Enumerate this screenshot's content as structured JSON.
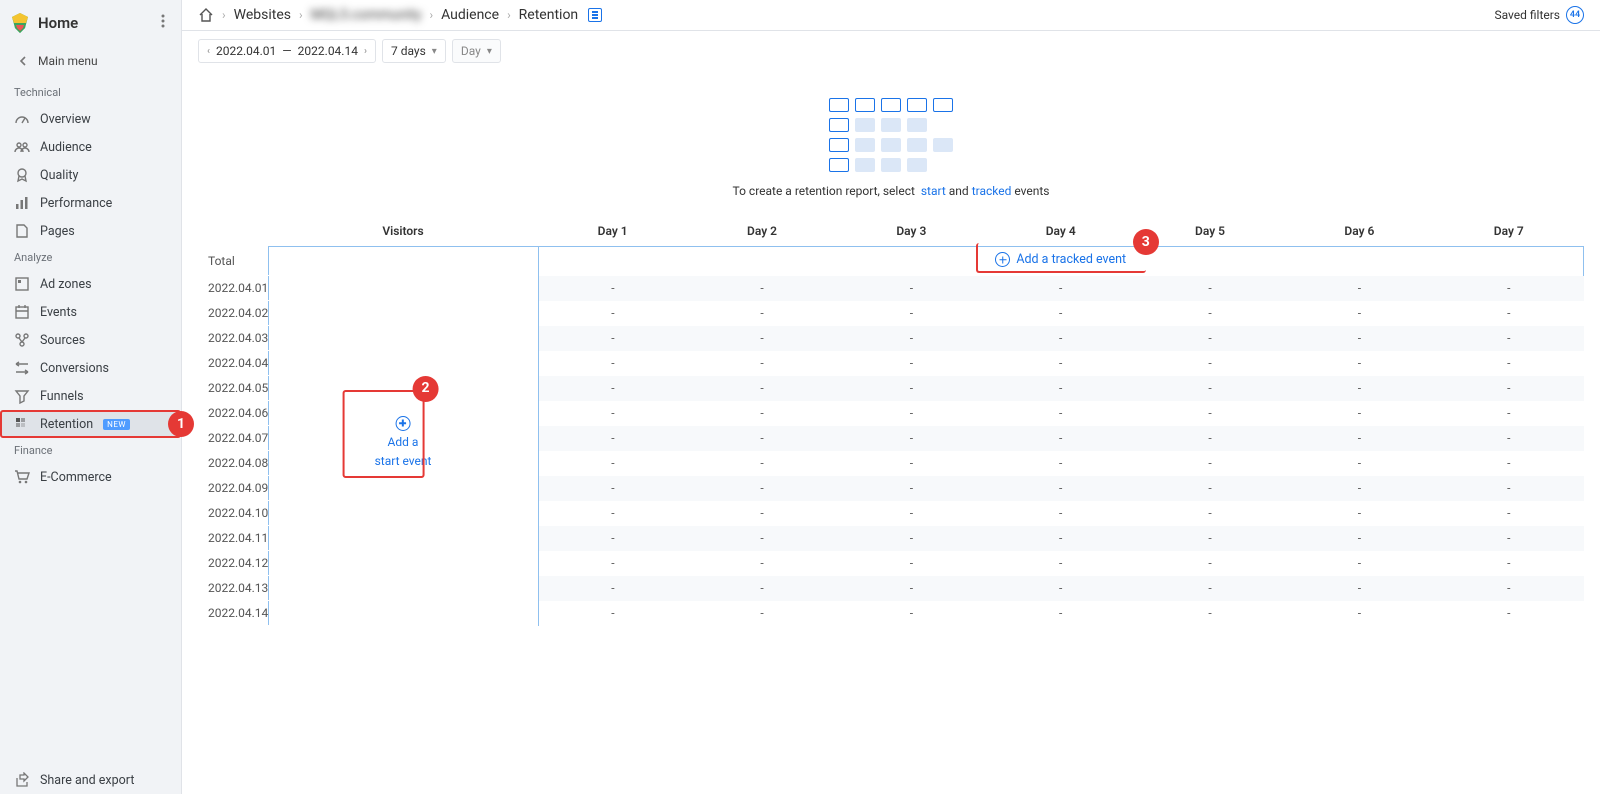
{
  "sidebar": {
    "title": "Home",
    "main_menu": "Main menu",
    "groups": [
      {
        "label": "Technical",
        "items": [
          {
            "icon": "speedometer",
            "label": "Overview"
          },
          {
            "icon": "audience",
            "label": "Audience"
          },
          {
            "icon": "medal",
            "label": "Quality"
          },
          {
            "icon": "bars",
            "label": "Performance"
          },
          {
            "icon": "page",
            "label": "Pages"
          }
        ]
      },
      {
        "label": "Analyze",
        "items": [
          {
            "icon": "adzones",
            "label": "Ad zones"
          },
          {
            "icon": "events",
            "label": "Events"
          },
          {
            "icon": "sources",
            "label": "Sources"
          },
          {
            "icon": "conversions",
            "label": "Conversions"
          },
          {
            "icon": "funnel",
            "label": "Funnels"
          },
          {
            "icon": "retention",
            "label": "Retention",
            "badge": "NEW",
            "active": true
          }
        ]
      },
      {
        "label": "Finance",
        "items": [
          {
            "icon": "cart",
            "label": "E-Commerce"
          }
        ]
      }
    ],
    "share_export": "Share and export"
  },
  "breadcrumbs": {
    "websites": "Websites",
    "site": "MQL5.community",
    "audience": "Audience",
    "retention": "Retention"
  },
  "top": {
    "saved_filters": "Saved filters",
    "saved_filters_count": "44"
  },
  "controls": {
    "date_from": "2022.04.01",
    "date_sep": "—",
    "date_to": "2022.04.14",
    "range": "7 days",
    "granularity": "Day"
  },
  "illus_caption": {
    "pre": "To create a retention report, select",
    "start": "start",
    "and": "and",
    "tracked": "tracked",
    "post": "events"
  },
  "table": {
    "headers": {
      "visitors": "Visitors",
      "days": [
        "Day 1",
        "Day 2",
        "Day 3",
        "Day 4",
        "Day 5",
        "Day 6",
        "Day 7"
      ]
    },
    "total_label": "Total",
    "add_tracked": "Add a tracked event",
    "add_start_l1": "Add a",
    "add_start_l2": "start event",
    "dates": [
      "2022.04.01",
      "2022.04.02",
      "2022.04.03",
      "2022.04.04",
      "2022.04.05",
      "2022.04.06",
      "2022.04.07",
      "2022.04.08",
      "2022.04.09",
      "2022.04.10",
      "2022.04.11",
      "2022.04.12",
      "2022.04.13",
      "2022.04.14"
    ],
    "cell_placeholder": "-"
  },
  "annotations": {
    "1": "1",
    "2": "2",
    "3": "3"
  }
}
